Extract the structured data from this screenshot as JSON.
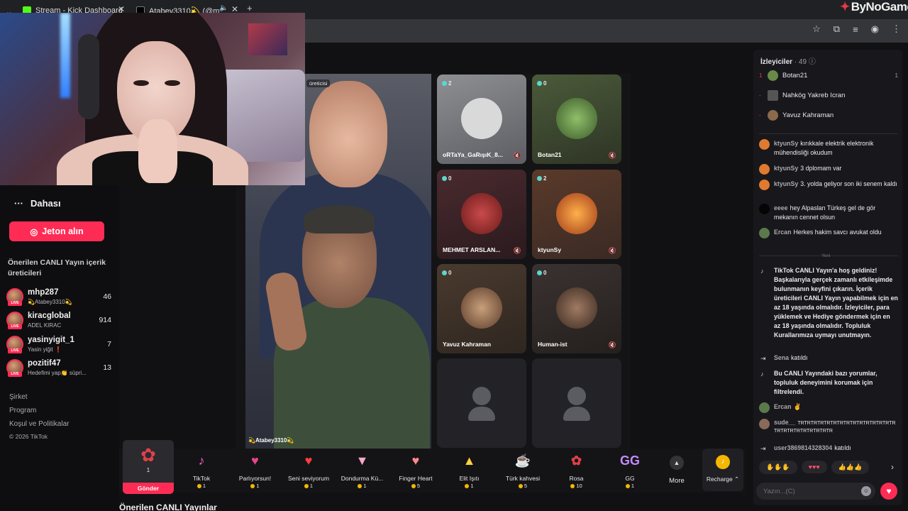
{
  "browser": {
    "tabs": [
      {
        "label": "Stream - Kick Dashboard",
        "color": "#53fc18"
      },
      {
        "label": "Atabey3310💫 (@mhp2...",
        "color": "#ffffff"
      }
    ],
    "new_tab": "+",
    "brand": "ByNoGame"
  },
  "sidebar": {
    "more_label": "Dahası",
    "coins_button": "Jeton alın",
    "suggested_title": "Önerilen CANLI Yayın içerik üreticileri",
    "creators": [
      {
        "name": "mhp287",
        "sub": "💫Atabey3310💫",
        "count": "46"
      },
      {
        "name": "kiracglobal",
        "sub": "ADEL KIRAC",
        "count": "914"
      },
      {
        "name": "yasinyigit_1",
        "sub": "Yasin yiğit ❗",
        "count": "7"
      },
      {
        "name": "pozitif47",
        "sub": "Hedefimi yap👏 süpri...",
        "count": "13"
      }
    ],
    "live_badge": "LIVE",
    "footer": [
      "Şirket",
      "Program",
      "Koşul ve Politikalar",
      "© 2026 TikTok"
    ]
  },
  "stage": {
    "host_label": "üreticisi",
    "host_name": "💫Atabey3310💫",
    "tiles": [
      {
        "name": "oRTaYa_GaRışıK_8...",
        "count": "2",
        "avatar_color": "#d9d9d9"
      },
      {
        "name": "Botan21",
        "count": "0",
        "avatar_color": "#4a7a3a"
      },
      {
        "name": "MEHMET ARSLAN...",
        "count": "0",
        "avatar_color": "#a52a2a"
      },
      {
        "name": "ktyunSy",
        "count": "2",
        "avatar_color": "#e07a30"
      },
      {
        "name": "Yavuz Kahraman",
        "count": "0",
        "avatar_color": "#7a5a3a"
      },
      {
        "name": "Human-ist",
        "count": "0",
        "avatar_color": "#5a4a42"
      }
    ]
  },
  "gifts": {
    "featured": {
      "price": "1",
      "send": "Gönder"
    },
    "items": [
      {
        "name": "TikTok",
        "price": "1",
        "icon": "♪",
        "color": "#ff5acd"
      },
      {
        "name": "Parlıyorsun!",
        "price": "1",
        "icon": "♥",
        "color": "#e8458b"
      },
      {
        "name": "Seni seviyorum",
        "price": "1",
        "icon": "♥",
        "color": "#ff3d3d"
      },
      {
        "name": "Dondurma Kü...",
        "price": "1",
        "icon": "▼",
        "color": "#f7a8d0"
      },
      {
        "name": "Finger Heart",
        "price": "5",
        "icon": "♥",
        "color": "#ff8a8a"
      },
      {
        "name": "Elit Işıtı",
        "price": "1",
        "icon": "▲",
        "color": "#ffd23f"
      },
      {
        "name": "Türk kahvesi",
        "price": "5",
        "icon": "☕",
        "color": "#e9e9e9"
      },
      {
        "name": "Rosa",
        "price": "10",
        "icon": "✿",
        "color": "#e0404a"
      },
      {
        "name": "GG",
        "price": "1",
        "icon": "GG",
        "color": "#c38bff"
      }
    ],
    "more": "More",
    "recharge": "Recharge"
  },
  "section_below": "Önerilen CANLI Yayınlar",
  "chat": {
    "viewers_title": "İzleyiciler",
    "viewers_count": "· 49",
    "top_viewers": [
      {
        "rank": "1",
        "name": "Botan21",
        "count": "1",
        "color": "#6a8a4a"
      },
      {
        "rank": "-",
        "name": "Nahkög Yakreb Icran",
        "count": "",
        "color": "#555"
      },
      {
        "rank": "-",
        "name": "Yavuz Kahraman",
        "count": "",
        "color": "#8a6a4a"
      }
    ],
    "new_label": "Yeni",
    "messages": [
      {
        "user": "ktyunSy",
        "text": "kırıkkale elektrik elektronik mühendisliği okudum",
        "color": "#e07a30"
      },
      {
        "user": "ktyunSy",
        "text": "3 dplomam var",
        "color": "#e07a30"
      },
      {
        "user": "ktyunSy",
        "text": "3. yolda geliyor son iki senem kaldı",
        "color": "#e07a30"
      },
      {
        "user": "eeee",
        "text": "hey Alpaslan Türkeş gel de gör mekanın cennet olsun",
        "color": "#111"
      },
      {
        "user": "Ercan",
        "text": "Herkes hakim savcı avukat oldu",
        "color": "#5a7a4a"
      }
    ],
    "welcome": "TikTok CANLI Yayın'a hoş geldiniz! Başkalarıyla gerçek zamanlı etkileşimde bulunmanın keyfini çıkarın. İçerik üreticileri CANLI Yayın yapabilmek için en az 18 yaşında olmalıdır. İzleyiciler, para yüklemek ve Hediye göndermek için en az 18 yaşında olmalıdır. Topluluk Kurallarımıza uymayı unutmayın.",
    "joined1_user": "Sena",
    "joined_label": "katıldı",
    "filter_notice": "Bu CANLI Yayındaki bazı yorumlar, topluluk deneyimini korumak için filtrelendi.",
    "msg_ercan2": {
      "user": "Ercan",
      "text": "✌"
    },
    "msg_sude": {
      "user": "sude__",
      "text": "TRTRTRTRTRTRTRTRTRTRTRTRTRTRTRTRTRTRTRTRTRTRTRTR"
    },
    "joined2_user": "user3869814328304",
    "quick_reactions": [
      "✋✋✋",
      "♥♥♥",
      "👍👍👍"
    ],
    "input_placeholder": "Yazın...(C)"
  }
}
